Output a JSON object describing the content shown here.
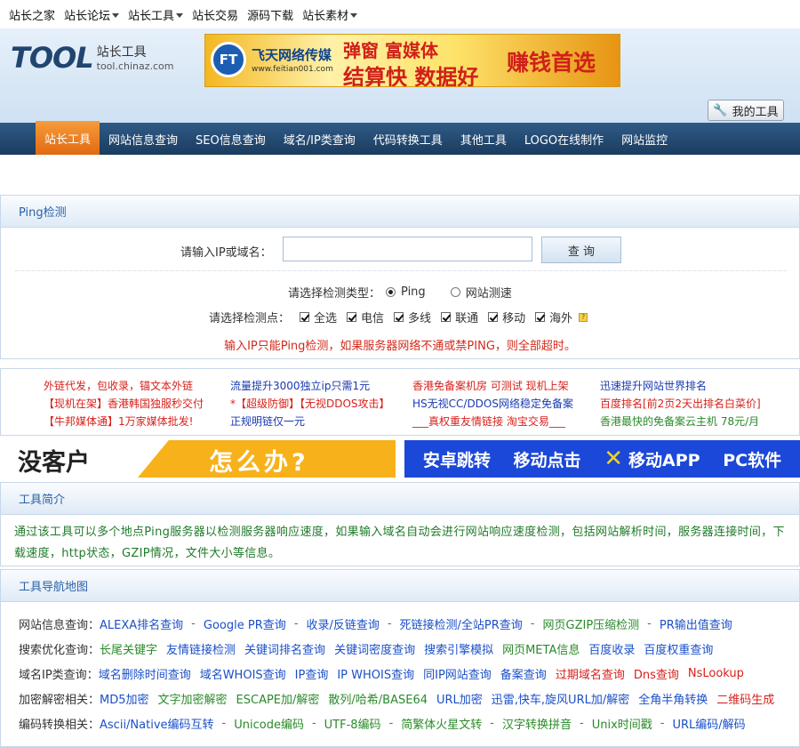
{
  "topbar": {
    "items": [
      {
        "label": "站长之家",
        "dropdown": false
      },
      {
        "label": "站长论坛",
        "dropdown": true
      },
      {
        "label": "站长工具",
        "dropdown": true
      },
      {
        "label": "站长交易",
        "dropdown": false
      },
      {
        "label": "源码下载",
        "dropdown": false
      },
      {
        "label": "站长素材",
        "dropdown": true
      }
    ]
  },
  "logo": {
    "big": "TOOL",
    "name": "站长工具",
    "domain": "tool.chinaz.com"
  },
  "banner": {
    "logo_text": "FT",
    "company": "飞天网络传媒",
    "company_url": "www.feitian001.com",
    "line1": "弹窗 富媒体",
    "line2": "结算快 数据好",
    "slogan": "赚钱首选"
  },
  "nav": {
    "items": [
      "站长工具",
      "网站信息查询",
      "SEO信息查询",
      "域名/IP类查询",
      "代码转换工具",
      "其他工具",
      "LOGO在线制作",
      "网站监控"
    ],
    "active": "站长工具",
    "my_tools": "我的工具"
  },
  "ping": {
    "title": "Ping检测",
    "input_label": "请输入IP或域名：",
    "input_value": "",
    "query_button": "查 询",
    "type_label": "请选择检测类型：",
    "type_options": [
      {
        "label": "Ping",
        "selected": true
      },
      {
        "label": "网站测速",
        "selected": false
      }
    ],
    "point_label": "请选择检测点：",
    "points": [
      {
        "label": "全选",
        "checked": true
      },
      {
        "label": "电信",
        "checked": true
      },
      {
        "label": "多线",
        "checked": true
      },
      {
        "label": "联通",
        "checked": true
      },
      {
        "label": "移动",
        "checked": true
      },
      {
        "label": "海外",
        "checked": true
      }
    ],
    "help_mark": "?",
    "warning": "输入IP只能Ping检测，如果服务器网络不通或禁PING，则全部超时。"
  },
  "ads": {
    "col1": [
      "外链代发，包收录，锚文本外链",
      "【现机在架】香港韩国独服秒交付",
      "【牛邦媒体通】1万家媒体批发!"
    ],
    "col2": [
      "流量提升3000独立ip只需1元",
      "*【超级防御】【无视DDOS攻击】",
      "正规明链仅一元"
    ],
    "col3": [
      "香港免备案机房 可测试 现机上架",
      "HS无视CC/DDOS网络稳定免备案",
      "___真权重友情链接 淘宝交易___"
    ],
    "col4": [
      "迅速提升网站世界排名",
      "百度排名[前2页2天出排名白菜价]",
      "香港最快的免备案云主机 78元/月"
    ],
    "colors": {
      "red": "#d8201a",
      "blue": "#1a3ab0",
      "green": "#2a8a2a"
    }
  },
  "banner2": {
    "left_text1": "没客户",
    "left_text2": "怎么办?",
    "right_items": [
      "安卓跳转",
      "移动点击",
      "移动APP",
      "PC软件"
    ]
  },
  "intro": {
    "title": "工具简介",
    "text": "通过该工具可以多个地点Ping服务器以检测服务器响应速度，如果输入域名自动会进行网站响应速度检测，包括网站解析时间，服务器连接时间，下载速度，http状态，GZIP情况，文件大小等信息。"
  },
  "navmap": {
    "title": "工具导航地图",
    "rows": [
      {
        "label": "网站信息查询：",
        "sep": "dash",
        "links": [
          {
            "t": "ALEXA排名查询",
            "c": "#1a4fc8"
          },
          {
            "t": "Google PR查询",
            "c": "#1a4fc8"
          },
          {
            "t": "收录/反链查询",
            "c": "#1a4fc8"
          },
          {
            "t": "死链接检测/全站PR查询",
            "c": "#1a4fc8"
          },
          {
            "t": "网页GZIP压缩检测",
            "c": "#2a8a2a"
          },
          {
            "t": "PR输出值查询",
            "c": "#1a4fc8"
          }
        ]
      },
      {
        "label": "搜索优化查询：",
        "sep": "space",
        "links": [
          {
            "t": "长尾关键字",
            "c": "#2a8a2a"
          },
          {
            "t": "友情链接检测",
            "c": "#1a4fc8"
          },
          {
            "t": "关键词排名查询",
            "c": "#1a4fc8"
          },
          {
            "t": "关键词密度查询",
            "c": "#1a4fc8"
          },
          {
            "t": "搜索引擎模拟",
            "c": "#1a4fc8"
          },
          {
            "t": "网页META信息",
            "c": "#2a8a2a"
          },
          {
            "t": "百度收录",
            "c": "#1a4fc8"
          },
          {
            "t": "百度权重查询",
            "c": "#1a4fc8"
          }
        ]
      },
      {
        "label": "域名IP类查询：",
        "sep": "space",
        "links": [
          {
            "t": "域名删除时间查询",
            "c": "#1a4fc8"
          },
          {
            "t": "域名WHOIS查询",
            "c": "#1a4fc8"
          },
          {
            "t": "IP查询",
            "c": "#1a4fc8"
          },
          {
            "t": "IP WHOIS查询",
            "c": "#1a4fc8"
          },
          {
            "t": "同IP网站查询",
            "c": "#1a4fc8"
          },
          {
            "t": "备案查询",
            "c": "#1a4fc8"
          },
          {
            "t": "过期域名查询",
            "c": "#d8201a"
          },
          {
            "t": "Dns查询",
            "c": "#d8201a"
          },
          {
            "t": "NsLookup",
            "c": "#d8201a"
          }
        ]
      },
      {
        "label": "加密解密相关：",
        "sep": "space",
        "links": [
          {
            "t": "MD5加密",
            "c": "#1a4fc8"
          },
          {
            "t": "文字加密解密",
            "c": "#2a8a2a"
          },
          {
            "t": "ESCAPE加/解密",
            "c": "#2a8a2a"
          },
          {
            "t": "散列/哈希/BASE64",
            "c": "#2a8a2a"
          },
          {
            "t": "URL加密",
            "c": "#1a4fc8"
          },
          {
            "t": "迅雷,快车,旋风URL加/解密",
            "c": "#1a4fc8"
          },
          {
            "t": "全角半角转换",
            "c": "#1a4fc8"
          },
          {
            "t": "二维码生成",
            "c": "#d8201a"
          }
        ]
      },
      {
        "label": "编码转换相关：",
        "sep": "dash",
        "links": [
          {
            "t": "Ascii/Native编码互转",
            "c": "#1a4fc8"
          },
          {
            "t": "Unicode编码",
            "c": "#2a8a2a"
          },
          {
            "t": "UTF-8编码",
            "c": "#2a8a2a"
          },
          {
            "t": "简繁体火星文转",
            "c": "#2a8a2a"
          },
          {
            "t": "汉字转换拼音",
            "c": "#2a8a2a"
          },
          {
            "t": "Unix时间戳",
            "c": "#2a8a2a"
          },
          {
            "t": "URL编码/解码",
            "c": "#1a4fc8"
          }
        ]
      }
    ]
  }
}
